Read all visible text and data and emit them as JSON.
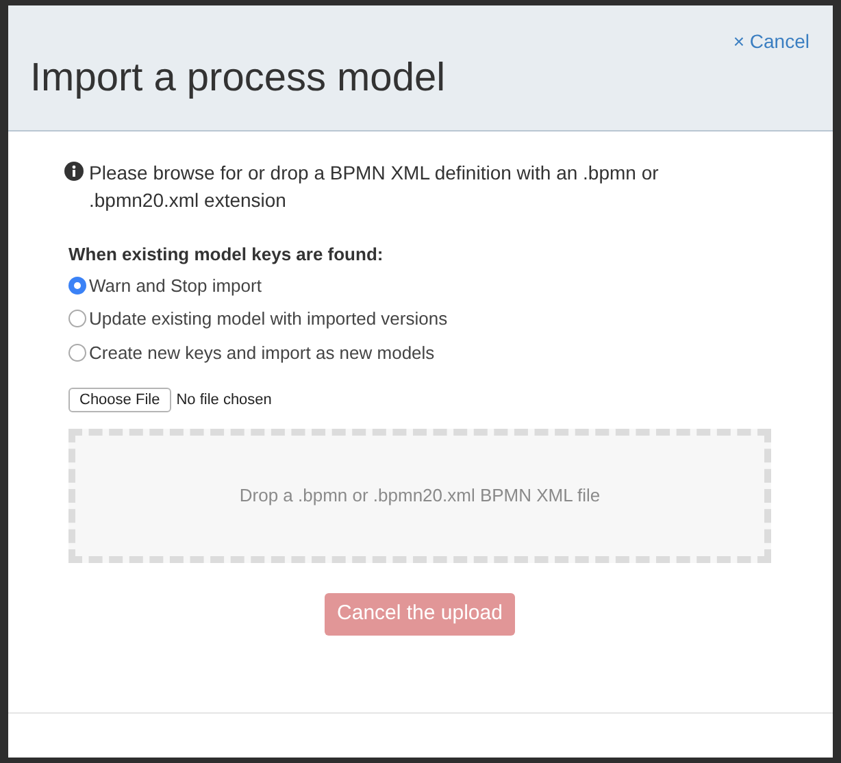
{
  "dialog": {
    "title": "Import a process model",
    "close_link": "× Cancel"
  },
  "info": "Please browse for or drop a BPMN XML definition with an .bpmn or .bpmn20.xml extension",
  "options_label": "When existing model keys are found:",
  "options": [
    {
      "label": "Warn and Stop import",
      "selected": true
    },
    {
      "label": "Update existing model with imported versions",
      "selected": false
    },
    {
      "label": "Create new keys and import as new models",
      "selected": false
    }
  ],
  "file_input": {
    "button": "Choose File",
    "status": "No file chosen"
  },
  "drop_zone": {
    "text": "Drop a .bpmn or .bpmn20.xml BPMN XML file"
  },
  "cancel_upload": {
    "label": "Cancel the upload",
    "disabled": true
  }
}
